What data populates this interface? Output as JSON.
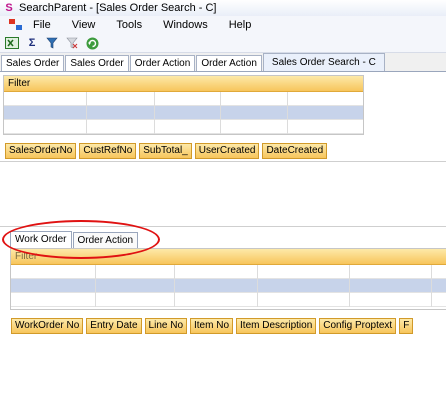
{
  "window": {
    "title": "SearchParent - [Sales Order Search - C]"
  },
  "menu": [
    "File",
    "View",
    "Tools",
    "Windows",
    "Help"
  ],
  "toolbar_icons": [
    "excel-icon",
    "sigma-icon",
    "filter-icon",
    "clear-filter-icon",
    "refresh-icon"
  ],
  "doc_tabs": [
    "Sales Order",
    "Sales Order",
    "Order Action",
    "Order Action",
    "Sales Order Search - C"
  ],
  "top_panel": {
    "title": "Filter"
  },
  "search_columns": [
    "SalesOrderNo",
    "CustRefNo",
    "SubTotal_",
    "UserCreated",
    "DateCreated"
  ],
  "sub_tabs": [
    "Work Order",
    "Order Action"
  ],
  "bottom_panel": {
    "title": "Filter"
  },
  "work_columns": [
    "WorkOrder No",
    "Entry Date",
    "Line No",
    "Item No",
    "Item Description",
    "Config Proptext",
    "F"
  ],
  "colors": {
    "header_gradient_top": "#fde9a9",
    "header_gradient_bottom": "#f7c55c",
    "selected_row": "#c7d3ea",
    "annotation": "#e01212"
  }
}
